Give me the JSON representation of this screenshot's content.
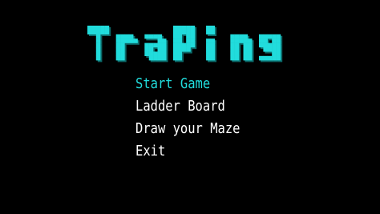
{
  "title": {
    "text": "TraPing",
    "color": "#21dcdc",
    "shadow_color": "#0c6a6a"
  },
  "menu": {
    "items": [
      {
        "label": "Start Game",
        "selected": true
      },
      {
        "label": "Ladder Board",
        "selected": false
      },
      {
        "label": "Draw your Maze",
        "selected": false
      },
      {
        "label": "Exit",
        "selected": false
      }
    ],
    "selected_color": "#21dcdc",
    "default_color": "#ffffff"
  },
  "background_color": "#000000"
}
